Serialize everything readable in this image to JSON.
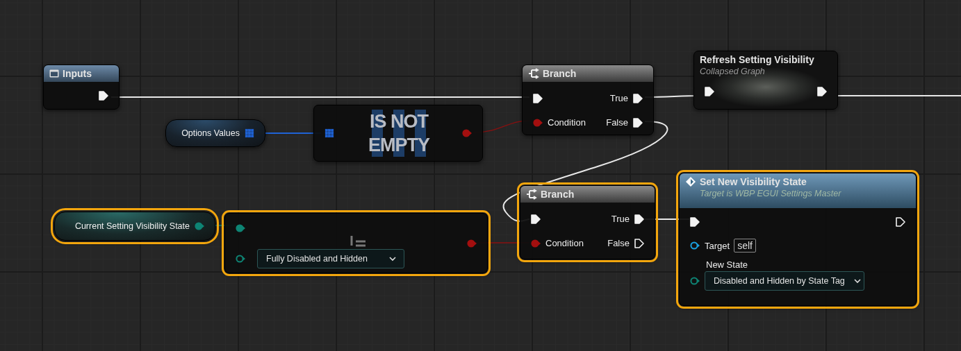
{
  "graph": {
    "nodes": [
      {
        "kind": "function-entry",
        "title": "Inputs",
        "selected": false,
        "outputs": [
          {
            "kind": "exec",
            "connected": true
          }
        ]
      },
      {
        "kind": "variable",
        "title": "Options Values",
        "selected": false,
        "outputs": [
          {
            "kind": "array",
            "connected": true
          }
        ]
      },
      {
        "kind": "compact",
        "title": "IS NOT EMPTY",
        "selected": false,
        "inputs": [
          {
            "kind": "array",
            "connected": true
          }
        ],
        "outputs": [
          {
            "kind": "bool",
            "connected": true
          }
        ]
      },
      {
        "kind": "branch",
        "title": "Branch",
        "selected": false,
        "inputs": [
          {
            "kind": "exec",
            "connected": true
          },
          {
            "kind": "bool",
            "connected": true,
            "label": "Condition"
          }
        ],
        "outputs": [
          {
            "kind": "exec",
            "connected": true,
            "label": "True"
          },
          {
            "kind": "exec",
            "connected": true,
            "label": "False"
          }
        ]
      },
      {
        "kind": "collapsed",
        "title": "Refresh Setting Visibility",
        "subtitle": "Collapsed Graph",
        "selected": false,
        "inputs": [
          {
            "kind": "exec",
            "connected": true
          }
        ],
        "outputs": [
          {
            "kind": "exec",
            "connected": true
          }
        ]
      },
      {
        "kind": "variable",
        "title": "Current Setting Visibility State",
        "selected": true,
        "outputs": [
          {
            "kind": "enum",
            "connected": true
          }
        ]
      },
      {
        "kind": "compact",
        "selected": true,
        "inputs": [
          {
            "kind": "enum",
            "connected": true
          },
          {
            "kind": "enum",
            "connected": false,
            "dropdown": "Fully Disabled and Hidden"
          }
        ],
        "outputs": [
          {
            "kind": "bool",
            "connected": true
          }
        ]
      },
      {
        "kind": "branch",
        "title": "Branch",
        "selected": true,
        "inputs": [
          {
            "kind": "exec",
            "connected": true
          },
          {
            "kind": "bool",
            "connected": true,
            "label": "Condition"
          }
        ],
        "outputs": [
          {
            "kind": "exec",
            "connected": true,
            "label": "True"
          },
          {
            "kind": "exec",
            "connected": false,
            "label": "False"
          }
        ]
      },
      {
        "kind": "function-call",
        "title": "Set New Visibility State",
        "subtitle": "Target is WBP EGUI Settings Master",
        "selected": true,
        "inputs": [
          {
            "kind": "exec",
            "connected": true
          },
          {
            "kind": "object",
            "connected": false,
            "label": "Target",
            "value": "self"
          },
          {
            "kind": "enum",
            "connected": false,
            "label": "New State",
            "label_above": true,
            "dropdown": "Disabled and Hidden by State Tag"
          }
        ],
        "outputs": [
          {
            "kind": "exec",
            "connected": false
          }
        ]
      }
    ]
  }
}
